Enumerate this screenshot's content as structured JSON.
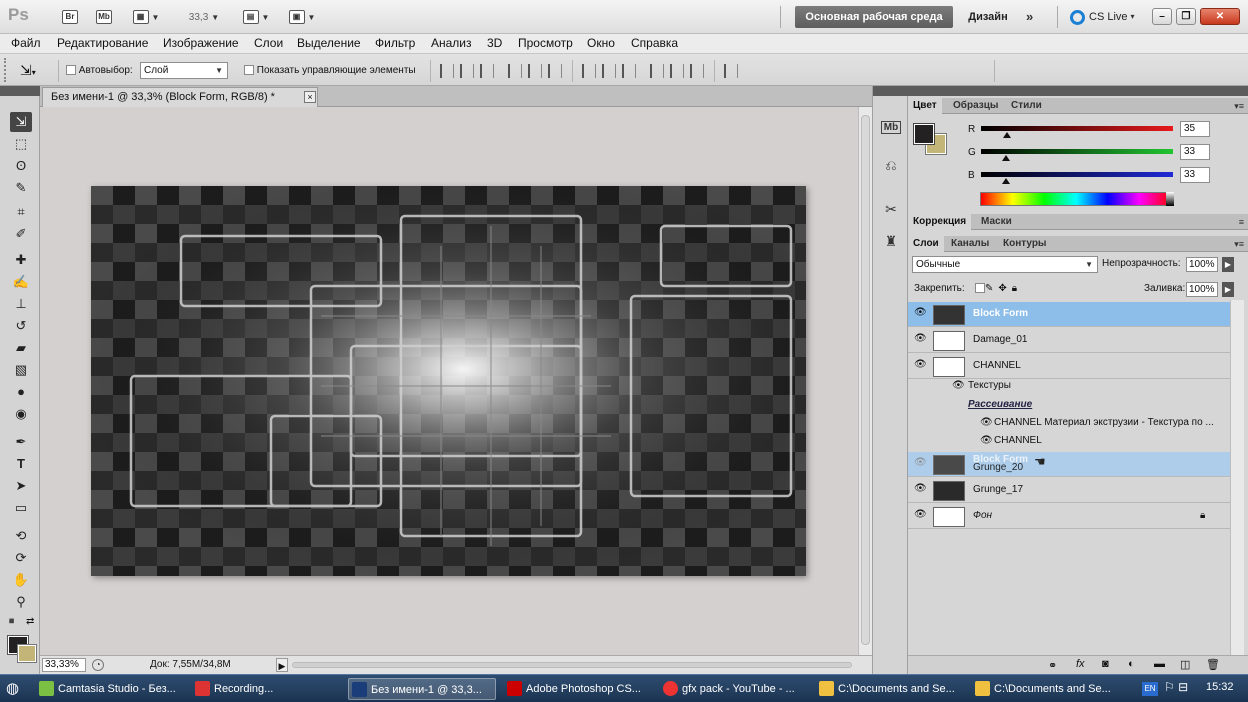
{
  "titlebar": {
    "app_logo": "Ps",
    "bridge": "Br",
    "minibridge": "Mb",
    "zoom": "33,3",
    "workspace_essentials": "Основная рабочая среда",
    "workspace_design": "Дизайн",
    "more": "»",
    "cs_live": "CS Live",
    "cs_live_arrow": "▾"
  },
  "menu": [
    "Файл",
    "Редактирование",
    "Изображение",
    "Слои",
    "Выделение",
    "Фильтр",
    "Анализ",
    "3D",
    "Просмотр",
    "Окно",
    "Справка"
  ],
  "options": {
    "autoselect_label": "Автовыбор:",
    "autoselect_value": "Слой",
    "show_controls_label": "Показать управляющие элементы"
  },
  "document": {
    "tab_title": "Без имени-1 @ 33,3% (Block Form, RGB/8) *",
    "close": "×",
    "zoom": "33,33%",
    "info": "Док: 7,55M/34,8M"
  },
  "color_panel": {
    "tabs": [
      "Цвет",
      "Образцы",
      "Стили"
    ],
    "channels": [
      {
        "label": "R",
        "value": "35",
        "fraction": 0.137,
        "color": "#e8191b"
      },
      {
        "label": "G",
        "value": "33",
        "fraction": 0.129,
        "color": "#21c531"
      },
      {
        "label": "B",
        "value": "33",
        "fraction": 0.129,
        "color": "#1f2ad6"
      }
    ],
    "fg_color": "#232121",
    "bg_color": "#c3b577"
  },
  "adjust_panel": {
    "tabs": [
      "Коррекция",
      "Маски"
    ]
  },
  "layers_panel": {
    "tabs": [
      "Слои",
      "Каналы",
      "Контуры"
    ],
    "blend_mode": "Обычные",
    "opacity_label": "Непрозрачность:",
    "opacity_value": "100%",
    "lock_label": "Закрепить:",
    "fill_label": "Заливка:",
    "fill_value": "100%",
    "layers": [
      {
        "name": "Block Form",
        "selected": true
      },
      {
        "name": "Damage_01",
        "selected": false
      },
      {
        "name": "CHANNEL",
        "selected": false
      },
      {
        "name": "Grunge_20",
        "selected": false
      },
      {
        "name": "Grunge_17",
        "selected": false
      },
      {
        "name": "Фон",
        "selected": false
      }
    ],
    "effects_label": "Текстуры",
    "effects_sub": "Рассеивание",
    "effect_items": [
      "CHANNEL Материал экструзии - Текстура по ...",
      "CHANNEL"
    ],
    "drag_ghost": "Block Form"
  },
  "taskbar": {
    "tasks": [
      "Camtasia Studio - Без...",
      "Recording...",
      "Без имени-1 @ 33,3...",
      "Adobe Photoshop CS...",
      "gfx pack - YouTube - ...",
      "C:\\Documents and Se...",
      "C:\\Documents and Se..."
    ],
    "lang": "EN",
    "clock": "15:32"
  }
}
